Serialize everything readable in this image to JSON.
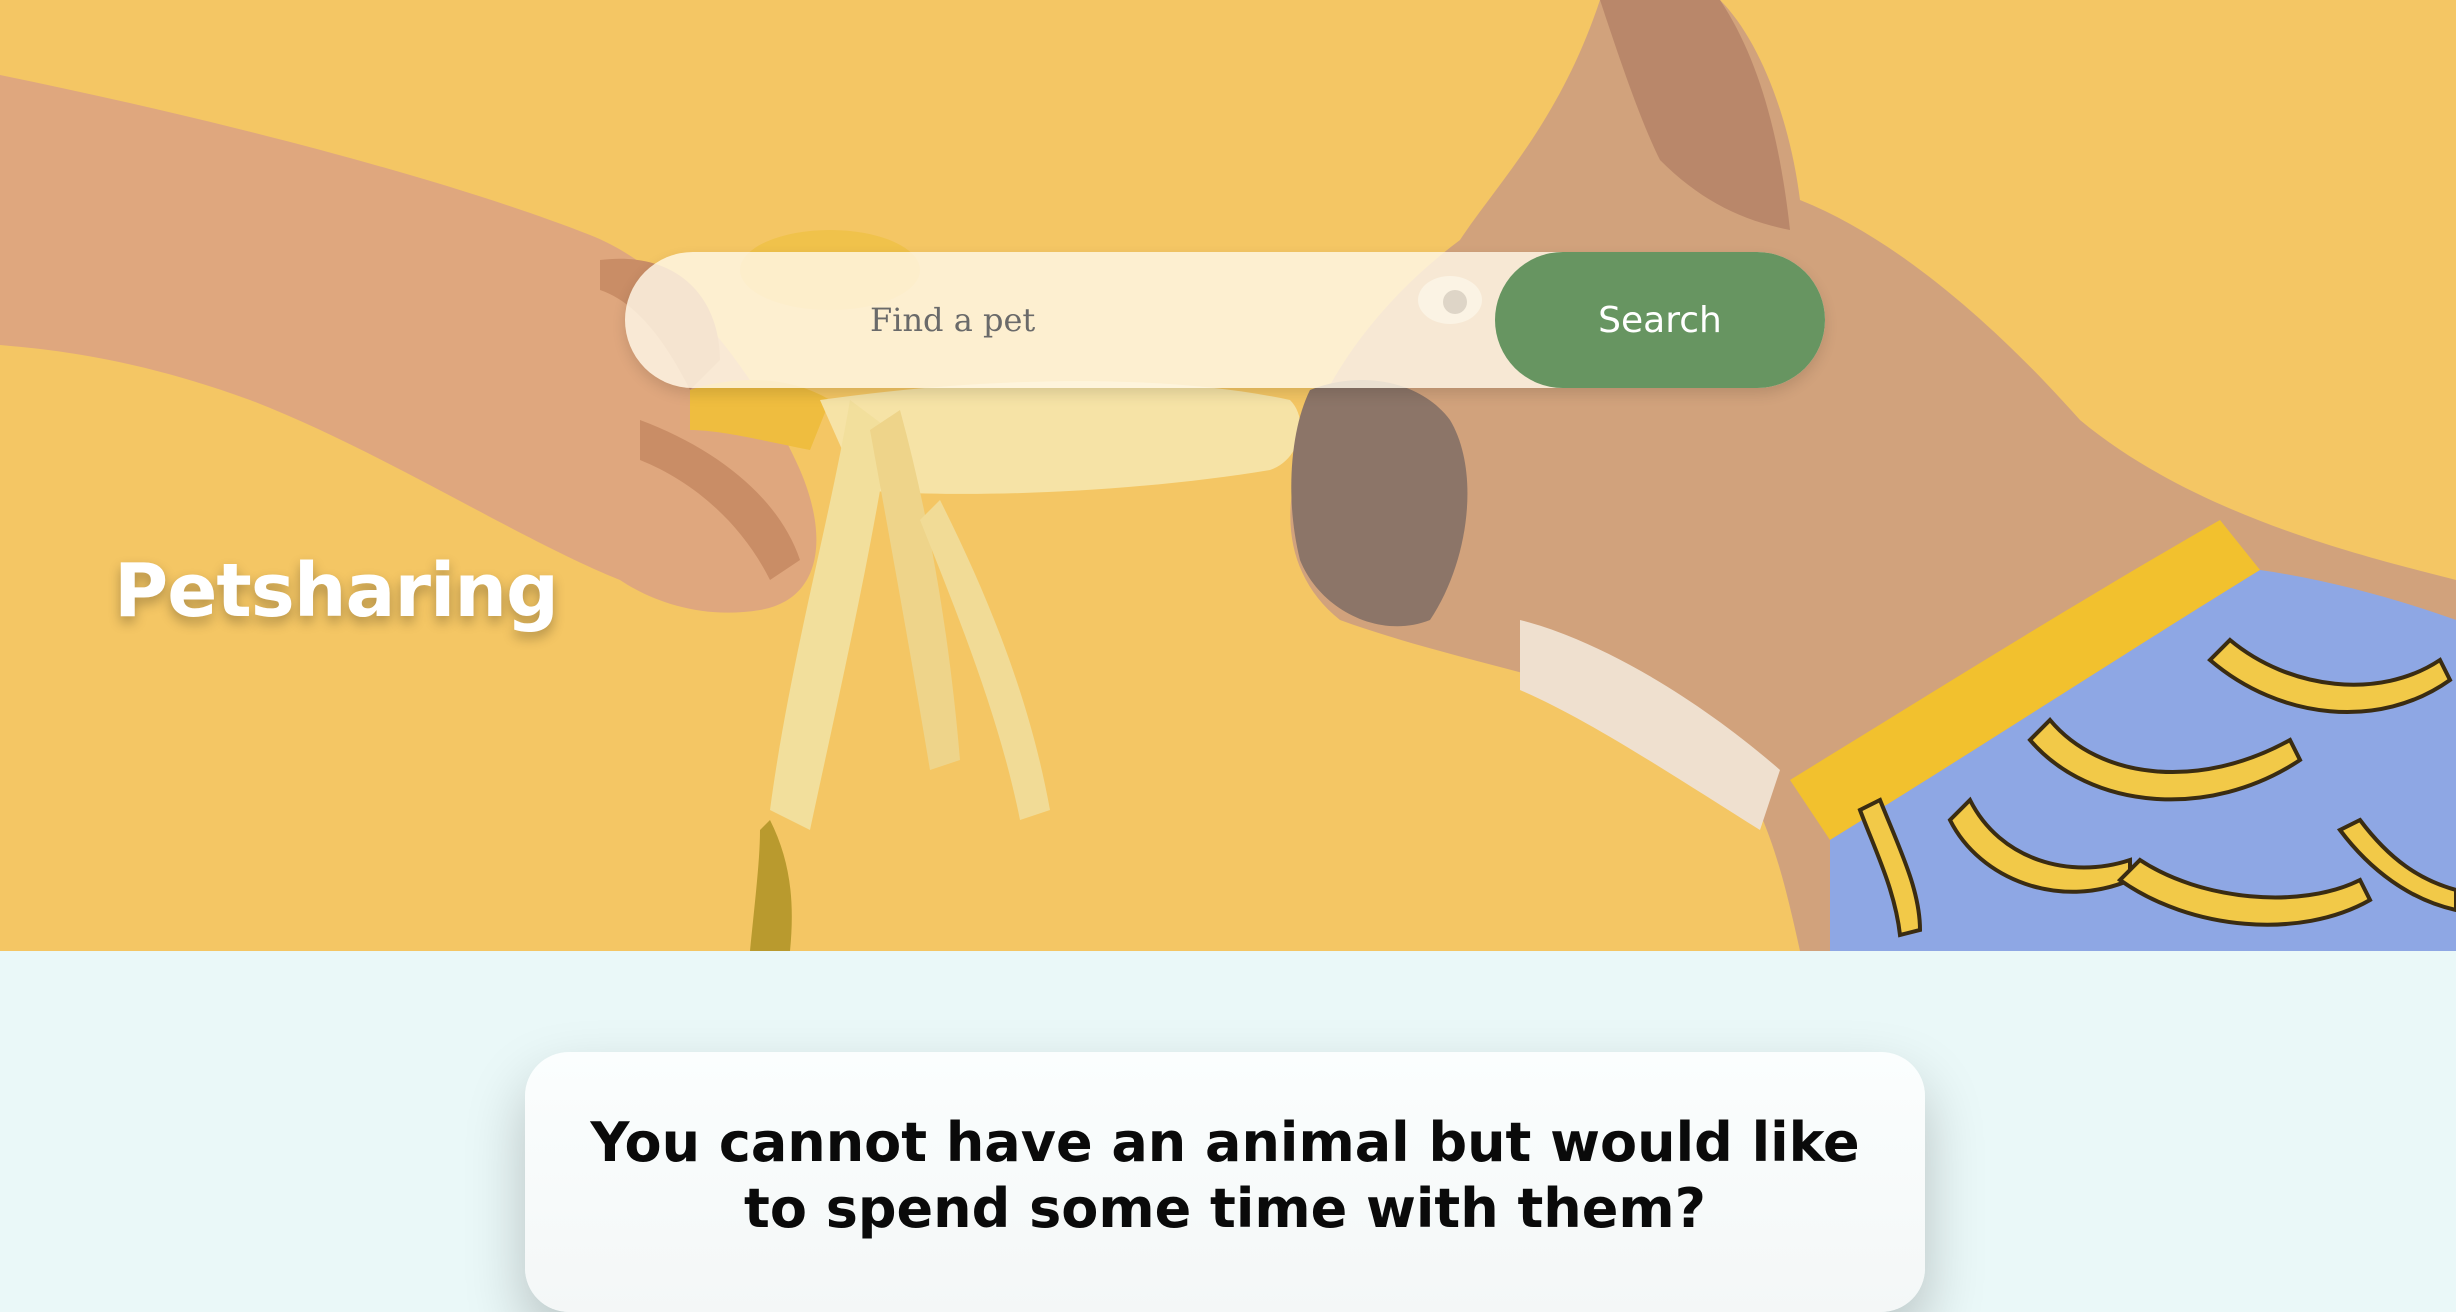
{
  "hero": {
    "brand": "Petsharing",
    "background_color": "#f5c767"
  },
  "search": {
    "placeholder": "Find a pet",
    "button_label": "Search",
    "button_color": "#679561"
  },
  "card": {
    "heading": "You cannot have an animal but would like to spend some time with them?"
  },
  "page": {
    "background_color": "#eaf8f8"
  }
}
